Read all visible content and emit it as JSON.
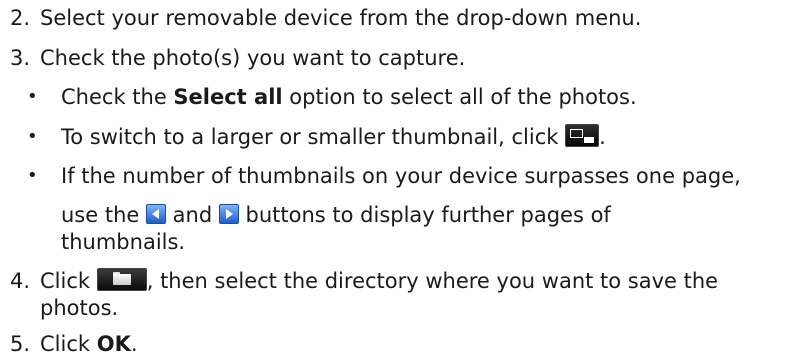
{
  "steps": {
    "s2": {
      "num": "2.",
      "text": "Select your removable device from the drop-down menu."
    },
    "s3": {
      "num": "3.",
      "text": "Check the photo(s) you want to capture."
    },
    "b1": {
      "pre": "Check the ",
      "bold": "Select all",
      "post": " option to select all of the photos."
    },
    "b2": {
      "pre": "To switch to a larger or smaller thumbnail, click ",
      "post": "."
    },
    "b3": {
      "line1": "If the number of thumbnails on your device surpasses one page,",
      "pre": "use the ",
      "mid": " and ",
      "post": " buttons to display further pages of",
      "line3": "thumbnails."
    },
    "s4": {
      "num": "4.",
      "pre": "Click ",
      "post": ", then select the directory where you want to save the",
      "line2": "photos."
    },
    "s5": {
      "num": "5.",
      "pre": "Click ",
      "bold": "OK",
      "post": "."
    }
  },
  "bullet": "•",
  "icons": {
    "thumbnail": "thumbnail-size-icon",
    "prev": "previous-page-icon",
    "next": "next-page-icon",
    "folder": "folder-browse-icon"
  },
  "colors": {
    "text": "#1a1a1a",
    "arrow": "#2a6de0",
    "icon_bg": "#111111"
  }
}
